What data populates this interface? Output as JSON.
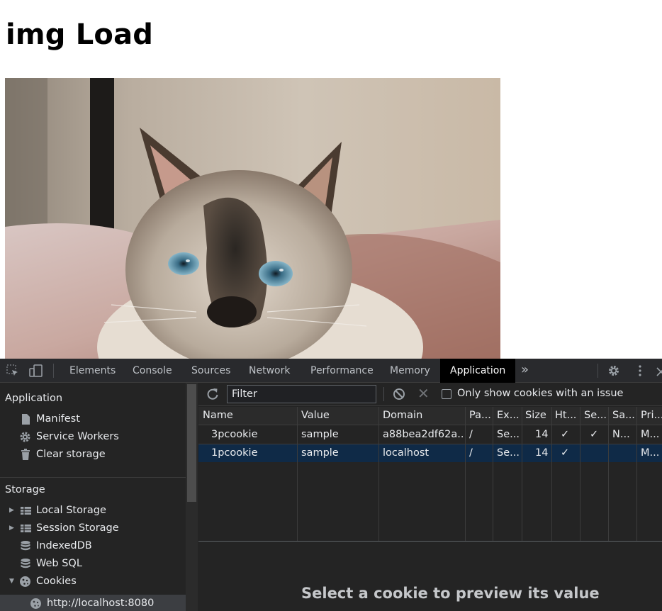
{
  "page": {
    "heading": "img Load",
    "image_alt": "cat photo"
  },
  "devtools": {
    "tabs": [
      {
        "label": "Elements"
      },
      {
        "label": "Console"
      },
      {
        "label": "Sources"
      },
      {
        "label": "Network"
      },
      {
        "label": "Performance"
      },
      {
        "label": "Memory"
      },
      {
        "label": "Application",
        "active": true
      }
    ],
    "more_tabs": "»",
    "sidebar": {
      "application_title": "Application",
      "application_items": [
        {
          "label": "Manifest",
          "icon": "file-icon"
        },
        {
          "label": "Service Workers",
          "icon": "gear-icon"
        },
        {
          "label": "Clear storage",
          "icon": "trash-icon"
        }
      ],
      "storage_title": "Storage",
      "storage_items": [
        {
          "label": "Local Storage",
          "icon": "grid-icon",
          "expandable": true
        },
        {
          "label": "Session Storage",
          "icon": "grid-icon",
          "expandable": true
        },
        {
          "label": "IndexedDB",
          "icon": "database-icon"
        },
        {
          "label": "Web SQL",
          "icon": "database-icon"
        },
        {
          "label": "Cookies",
          "icon": "cookie-icon",
          "expanded": true
        },
        {
          "label": "http://localhost:8080",
          "icon": "cookie-icon",
          "selected": true
        }
      ]
    },
    "cookies": {
      "filter_placeholder": "Filter",
      "issue_filter_label": "Only show cookies with an issue",
      "columns": [
        "Name",
        "Value",
        "Domain",
        "Pa...",
        "Ex...",
        "Size",
        "Ht...",
        "Se...",
        "Sa...",
        "Pri..."
      ],
      "rows": [
        {
          "name": "3pcookie",
          "value": "sample",
          "domain": "a88bea2df62a....",
          "path": "/",
          "expires": "Se...",
          "size": "14",
          "httponly": "✓",
          "secure": "✓",
          "samesite": "N...",
          "priority": "M..."
        },
        {
          "name": "1pcookie",
          "value": "sample",
          "domain": "localhost",
          "path": "/",
          "expires": "Se...",
          "size": "14",
          "httponly": "✓",
          "secure": "",
          "samesite": "",
          "priority": "M...",
          "selected": true
        }
      ],
      "preview_message": "Select a cookie to preview its value"
    }
  }
}
